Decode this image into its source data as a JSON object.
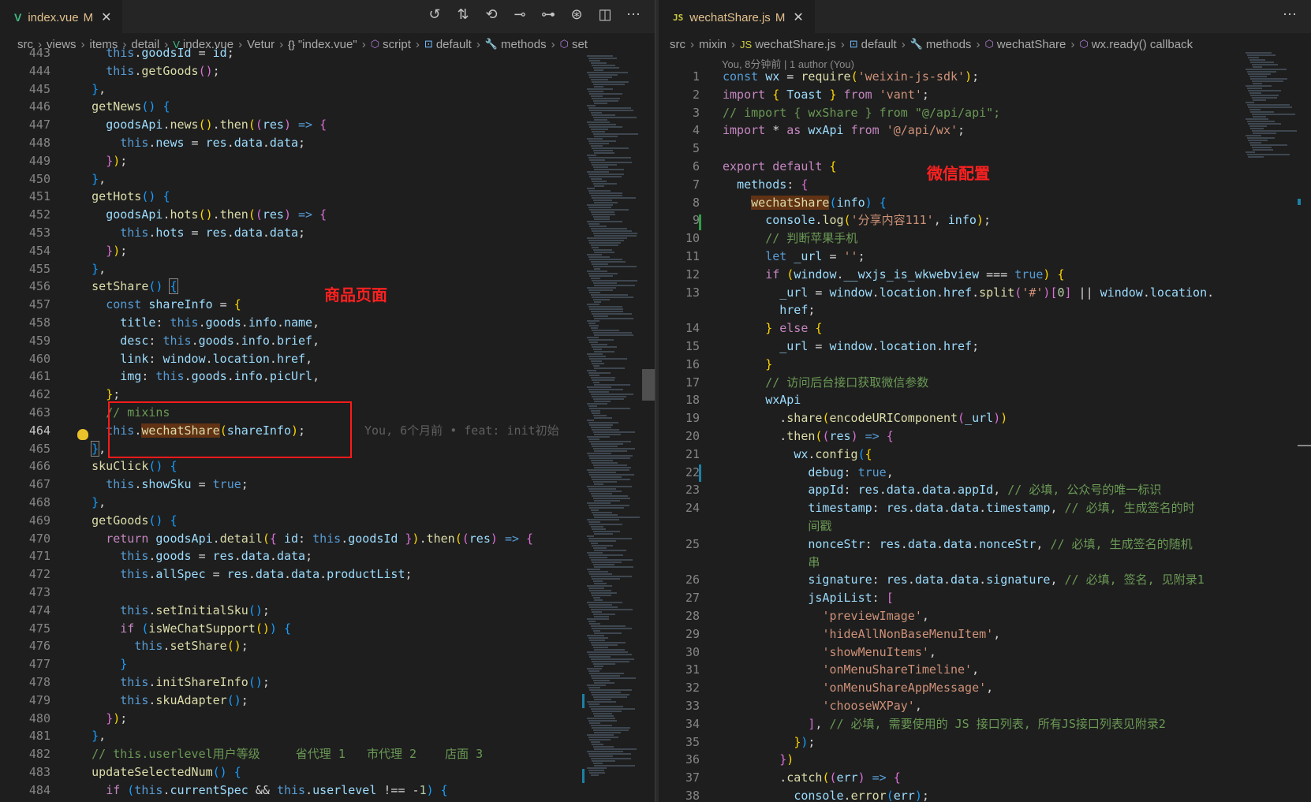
{
  "left_editor": {
    "tab": {
      "icon": "vue-file-icon",
      "filename": "index.vue",
      "status": "M"
    },
    "breadcrumb": [
      "src",
      "views",
      "items",
      "detail",
      "index.vue",
      "Vetur",
      "\"index.vue\"",
      "script",
      "default",
      "methods",
      "set"
    ],
    "annotation": "商品页面",
    "inline_blame": "You, 6个月前 • feat: init初始",
    "lines": [
      {
        "n": "443",
        "h": "      <span class='k'>this</span>.<span class='v'>goodsId</span> = <span class='v'>id</span>;"
      },
      {
        "n": "444",
        "h": "      <span class='k'>this</span>.<span class='f'>getGoods</span><span class='p'>()</span>;"
      },
      {
        "n": "445",
        "h": "    <span class='b'>}</span>,"
      },
      {
        "n": "446",
        "h": "    <span class='f'>getNews</span><span class='b'>()</span> <span class='b'>{</span>"
      },
      {
        "n": "447",
        "h": "      <span class='v'>goodsApi</span>.<span class='f'>news</span><span class='y'>()</span>.<span class='f'>then</span><span class='y'>(</span><span class='p'>(</span><span class='v'>res</span><span class='p'>)</span> <span class='k'>=&gt;</span> <span class='p'>{</span>"
      },
      {
        "n": "448",
        "h": "        <span class='k'>this</span>.<span class='v'>news</span> = <span class='v'>res</span>.<span class='v'>data</span>.<span class='v'>data</span>;"
      },
      {
        "n": "449",
        "h": "      <span class='p'>}</span><span class='y'>)</span>;"
      },
      {
        "n": "450",
        "h": "    <span class='b'>}</span>,"
      },
      {
        "n": "451",
        "h": "    <span class='f'>getHots</span><span class='b'>()</span> <span class='b'>{</span>"
      },
      {
        "n": "452",
        "h": "      <span class='v'>goodsApi</span>.<span class='f'>hots</span><span class='y'>()</span>.<span class='f'>then</span><span class='y'>(</span><span class='p'>(</span><span class='v'>res</span><span class='p'>)</span> <span class='k'>=&gt;</span> <span class='p'>{</span>"
      },
      {
        "n": "453",
        "h": "        <span class='k'>this</span>.<span class='v'>hots</span> = <span class='v'>res</span>.<span class='v'>data</span>.<span class='v'>data</span>;"
      },
      {
        "n": "454",
        "h": "      <span class='p'>}</span><span class='y'>)</span>;"
      },
      {
        "n": "455",
        "h": "    <span class='b'>}</span>,"
      },
      {
        "n": "456",
        "h": "    <span class='f'>setShare</span><span class='b'>()</span> <span class='b' style='outline:1px solid #888'>{</span>"
      },
      {
        "n": "457",
        "h": "      <span class='k'>const</span> <span class='v'>shareInfo</span> = <span class='y'>{</span>"
      },
      {
        "n": "458",
        "h": "        <span class='v'>title</span>: <span class='k'>this</span>.<span class='v'>goods</span>.<span class='v'>info</span>.<span class='v'>name</span>,"
      },
      {
        "n": "459",
        "h": "        <span class='v'>desc</span>: <span class='k'>this</span>.<span class='v'>goods</span>.<span class='v'>info</span>.<span class='v'>brief</span>,"
      },
      {
        "n": "460",
        "h": "        <span class='v'>link</span>: <span class='v'>window</span>.<span class='v'>location</span>.<span class='v'>href</span>,"
      },
      {
        "n": "461",
        "h": "        <span class='v'>img</span>: <span class='k'>this</span>.<span class='v'>goods</span>.<span class='v'>info</span>.<span class='v'>picUrl</span>,"
      },
      {
        "n": "462",
        "h": "      <span class='y'>}</span>;"
      },
      {
        "n": "463",
        "h": "      <span class='c'>// mixins</span>"
      },
      {
        "n": "464",
        "h": "      <span class='k'>this</span>.<span class='f hl-word'>wechatShare</span><span class='y'>(</span><span class='v'>shareInfo</span><span class='y'>)</span>;",
        "active": true
      },
      {
        "n": "465",
        "h": "    <span class='b' style='outline:1px solid #888'>}</span>,"
      },
      {
        "n": "466",
        "h": "    <span class='f'>skuClick</span><span class='b'>()</span> <span class='b'>{</span>"
      },
      {
        "n": "467",
        "h": "      <span class='k'>this</span>.<span class='v'>showSku</span> = <span class='k'>true</span>;"
      },
      {
        "n": "468",
        "h": "    <span class='b'>}</span>,"
      },
      {
        "n": "469",
        "h": "    <span class='f'>getGoods</span><span class='b'>()</span> <span class='b'>{</span>"
      },
      {
        "n": "470",
        "h": "      <span class='kw'>return</span> <span class='v'>goodsApi</span>.<span class='f'>detail</span><span class='y'>(</span><span class='p'>{</span> <span class='v'>id</span>: <span class='k'>this</span>.<span class='v'>goodsId</span> <span class='p'>}</span><span class='y'>)</span>.<span class='f'>then</span><span class='y'>(</span><span class='p'>(</span><span class='v'>res</span><span class='p'>)</span> <span class='k'>=&gt;</span> <span class='p'>{</span>"
      },
      {
        "n": "471",
        "h": "        <span class='k'>this</span>.<span class='v'>goods</span> = <span class='v'>res</span>.<span class='v'>data</span>.<span class='v'>data</span>;"
      },
      {
        "n": "472",
        "h": "        <span class='k'>this</span>.<span class='v'>allSpec</span> = <span class='v'>res</span>.<span class='v'>data</span>.<span class='v'>data</span>.<span class='v'>productList</span>;"
      },
      {
        "n": "473",
        "h": ""
      },
      {
        "n": "474",
        "h": "        <span class='k'>this</span>.<span class='f'>setInitialSku</span><span class='b'>()</span>;"
      },
      {
        "n": "475",
        "h": "        <span class='kw'>if</span> <span class='b'>(</span><span class='f'>isWeChatSupport</span><span class='y'>()</span><span class='b'>)</span> <span class='b'>{</span>"
      },
      {
        "n": "476",
        "h": "          <span class='k'>this</span>.<span class='f'>setShare</span><span class='y'>()</span>;"
      },
      {
        "n": "477",
        "h": "        <span class='b'>}</span>"
      },
      {
        "n": "478",
        "h": "        <span class='k'>this</span>.<span class='f'>initShareInfo</span><span class='b'>()</span>;"
      },
      {
        "n": "479",
        "h": "        <span class='k'>this</span>.<span class='f'>skuAdapter</span><span class='b'>()</span>;"
      },
      {
        "n": "480",
        "h": "      <span class='p'>}</span><span class='y'>)</span>;"
      },
      {
        "n": "481",
        "h": "    <span class='b'>}</span>,"
      },
      {
        "n": "482",
        "h": "    <span class='c'>// this.userlevel用户等级     省代理 1   市代理 2    店面 3</span>"
      },
      {
        "n": "483",
        "h": "    <span class='f'>updateSelectedNum</span><span class='b'>()</span> <span class='b'>{</span>"
      },
      {
        "n": "484",
        "h": "      <span class='kw'>if</span> <span class='b'>(</span><span class='k'>this</span>.<span class='v'>currentSpec</span> &amp;&amp; <span class='k'>this</span>.<span class='v'>userlevel</span> !== -<span class='n'>1</span><span class='b'>)</span> <span class='b'>{</span>"
      }
    ]
  },
  "right_editor": {
    "tab": {
      "icon": "js-file-icon",
      "icon_text": "JS",
      "filename": "wechatShare.js",
      "status": "M"
    },
    "breadcrumb": [
      "src",
      "mixin",
      "wechatShare.js",
      "default",
      "methods",
      "wechatShare",
      "wx.ready() callback"
    ],
    "blame_header": "You, 8分钟前 | 1 author (You)",
    "annotation": "微信配置",
    "lines": [
      {
        "n": "1",
        "h": "<span class='k'>const</span> <span class='v'>wx</span> = <span class='f'>require</span><span class='y'>(</span><span class='s'>'weixin-js-sdk'</span><span class='y'>)</span>;"
      },
      {
        "n": "2",
        "h": "<span class='kw'>import</span> <span class='y'>{</span> <span class='v'>Toast</span> <span class='y'>}</span> <span class='kw'>from</span> <span class='s'>'vant'</span>;"
      },
      {
        "n": "3",
        "h": "<span class='c'>// import { wxShare } from \"@/api/api\";</span>"
      },
      {
        "n": "4",
        "h": "<span class='kw'>import</span> * <span class='kw'>as</span> <span class='v'>wxApi</span> <span class='kw'>from</span> <span class='s'>'@/api/wx'</span>;"
      },
      {
        "n": "5",
        "h": ""
      },
      {
        "n": "6",
        "h": "<span class='kw'>export</span> <span class='kw'>default</span> <span class='y'>{</span>"
      },
      {
        "n": "7",
        "h": "  <span class='v'>methods</span>: <span class='p'>{</span>"
      },
      {
        "n": "8",
        "h": "    <span class='f hl-word'>wechatShare</span><span class='b'>(</span><span class='v'>info</span><span class='b'>)</span> <span class='b'>{</span>"
      },
      {
        "n": "9",
        "h": "      <span class='v'>console</span>.<span class='f'>log</span><span class='y'>(</span><span class='s'>'分享内容111'</span>, <span class='v'>info</span><span class='y'>)</span>;"
      },
      {
        "n": "10",
        "h": "      <span class='c'>// 判断苹果手机</span>"
      },
      {
        "n": "11",
        "h": "      <span class='k'>let</span> <span class='v'>_url</span> = <span class='s'>''</span>;"
      },
      {
        "n": "12",
        "h": "      <span class='kw'>if</span> <span class='y'>(</span><span class='v'>window</span>.<span class='v'>__wxjs_is_wkwebview</span> === <span class='k'>true</span><span class='y'>)</span> <span class='y'>{</span>"
      },
      {
        "n": "13",
        "h": "        <span class='v'>_url</span> = <span class='v'>window</span>.<span class='v'>location</span>.<span class='v'>href</span>.<span class='f'>split</span><span class='p'>(</span><span class='s'>'#'</span><span class='p'>)</span><span class='p'>[</span><span class='n'>0</span><span class='p'>]</span> || <span class='v'>window</span>.<span class='v'>location</span>."
      },
      {
        "n": "",
        "h": "        <span class='v'>href</span>;"
      },
      {
        "n": "14",
        "h": "      <span class='y'>}</span> <span class='kw'>else</span> <span class='y'>{</span>"
      },
      {
        "n": "15",
        "h": "        <span class='v'>_url</span> = <span class='v'>window</span>.<span class='v'>location</span>.<span class='v'>href</span>;"
      },
      {
        "n": "16",
        "h": "      <span class='y'>}</span>"
      },
      {
        "n": "17",
        "h": "      <span class='c'>// 访问后台接口获取微信参数</span>"
      },
      {
        "n": "18",
        "h": "      <span class='v'>wxApi</span>"
      },
      {
        "n": "19",
        "h": "        .<span class='f'>share</span><span class='y'>(</span><span class='f'>encodeURIComponent</span><span class='p'>(</span><span class='v'>_url</span><span class='p'>)</span><span class='y'>)</span>"
      },
      {
        "n": "20",
        "h": "        .<span class='f'>then</span><span class='y'>(</span><span class='p'>(</span><span class='v'>res</span><span class='p'>)</span> <span class='k'>=&gt;</span> <span class='p'>{</span>"
      },
      {
        "n": "21",
        "h": "          <span class='v'>wx</span>.<span class='f'>config</span><span class='b'>(</span><span class='y'>{</span>"
      },
      {
        "n": "22",
        "h": "            <span class='v'>debug</span>: <span class='k'>true</span>,"
      },
      {
        "n": "23",
        "h": "            <span class='v'>appId</span>: <span class='v'>res</span>.<span class='v'>data</span>.<span class='v'>data</span>.<span class='v'>appId</span>, <span class='c'>// 必填, 公众号的唯一标识</span>"
      },
      {
        "n": "24",
        "h": "            <span class='v'>timestamp</span>: <span class='v'>res</span>.<span class='v'>data</span>.<span class='v'>data</span>.<span class='v'>timestamp</span>, <span class='c'>// 必填, 生成签名的时</span>"
      },
      {
        "n": "",
        "h": "            <span class='c'>间戳</span>"
      },
      {
        "n": "25",
        "h": "            <span class='v'>nonceStr</span>: <span class='v'>res</span>.<span class='v'>data</span>.<span class='v'>data</span>.<span class='v'>nonceStr</span>, <span class='c'>// 必填, 生成签名的随机</span>"
      },
      {
        "n": "",
        "h": "            <span class='c'>串</span>"
      },
      {
        "n": "26",
        "h": "            <span class='v'>signature</span>: <span class='v'>res</span>.<span class='v'>data</span>.<span class='v'>data</span>.<span class='v'>signature</span>, <span class='c'>// 必填, 签名, 见附录1</span>"
      },
      {
        "n": "27",
        "h": "            <span class='v'>jsApiList</span>: <span class='p'>[</span>"
      },
      {
        "n": "28",
        "h": "              <span class='s'>'previewImage'</span>,"
      },
      {
        "n": "29",
        "h": "              <span class='s'>'hideAllNonBaseMenuItem'</span>,"
      },
      {
        "n": "30",
        "h": "              <span class='s'>'showMenuItems'</span>,"
      },
      {
        "n": "31",
        "h": "              <span class='s'>'onMenuShareTimeline'</span>,"
      },
      {
        "n": "32",
        "h": "              <span class='s'>'onMenuShareAppMessage'</span>,"
      },
      {
        "n": "33",
        "h": "              <span class='s'>'chooseWXPay'</span>,"
      },
      {
        "n": "34",
        "h": "            <span class='p'>]</span>, <span class='c'>// 必填, 需要使用的 JS 接口列表, 所有JS接口列表见附录2</span>"
      },
      {
        "n": "35",
        "h": "          <span class='y'>}</span><span class='b'>)</span>;"
      },
      {
        "n": "36",
        "h": "        <span class='p'>}</span><span class='y'>)</span>"
      },
      {
        "n": "37",
        "h": "        .<span class='f'>catch</span><span class='y'>(</span><span class='p'>(</span><span class='v'>err</span><span class='p'>)</span> <span class='k'>=&gt;</span> <span class='p'>{</span>"
      },
      {
        "n": "38",
        "h": "          <span class='v'>console</span>.<span class='f'>error</span><span class='b'>(</span><span class='v'>err</span><span class='b'>)</span>;"
      }
    ]
  }
}
